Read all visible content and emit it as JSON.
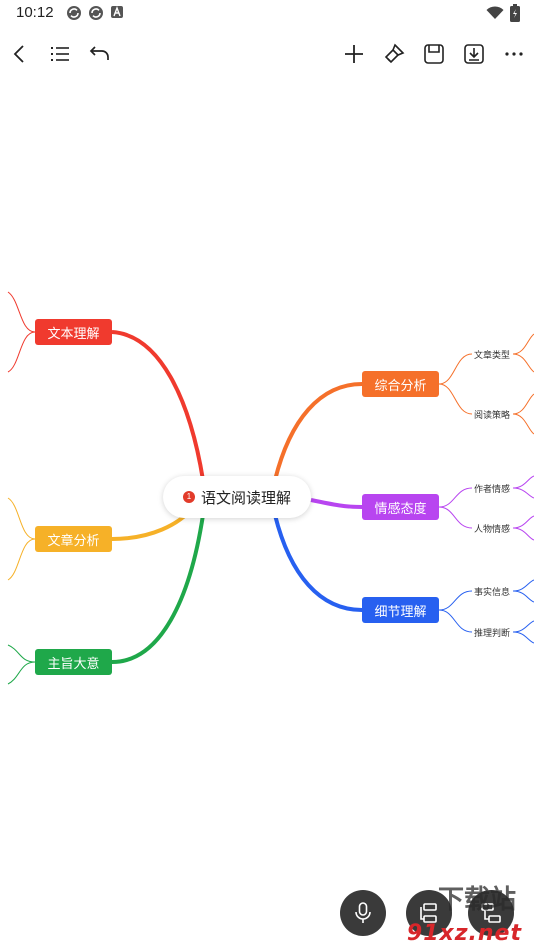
{
  "status_bar": {
    "time": "10:12",
    "icons": [
      "sync-icon",
      "sync-icon",
      "a-icon",
      "wifi-icon",
      "battery-icon"
    ]
  },
  "toolbar": {
    "left": [
      "back-icon",
      "outline-icon",
      "undo-icon"
    ],
    "right": [
      "add-icon",
      "brush-icon",
      "save-icon",
      "export-icon",
      "more-icon"
    ]
  },
  "mindmap": {
    "root": {
      "label": "语文阅读理解",
      "badge": "1"
    },
    "branches": [
      {
        "label": "文本理解",
        "color": "#f03a2e",
        "children": []
      },
      {
        "label": "文章分析",
        "color": "#f6b128",
        "children": []
      },
      {
        "label": "主旨大意",
        "color": "#1fa84a",
        "children": []
      },
      {
        "label": "综合分析",
        "color": "#f5702a",
        "children": [
          "文章类型",
          "阅读策略"
        ]
      },
      {
        "label": "情感态度",
        "color": "#b845f0",
        "children": [
          "作者情感",
          "人物情感"
        ]
      },
      {
        "label": "细节理解",
        "color": "#2760f0",
        "children": [
          "事实信息",
          "推理判断"
        ]
      }
    ]
  },
  "bottom": {
    "buttons": [
      "mic-icon",
      "add-sibling-icon",
      "add-child-icon"
    ]
  },
  "watermark": {
    "brand": "下载站",
    "url": "91xz.net"
  }
}
